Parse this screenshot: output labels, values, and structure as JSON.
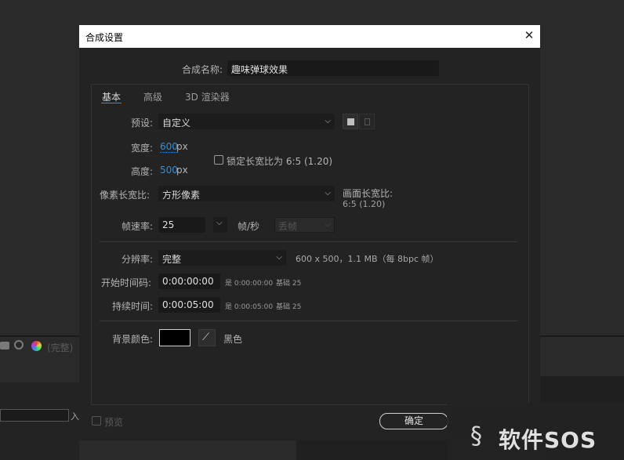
{
  "dialog": {
    "title": "合成设置",
    "close_glyph": "✕"
  },
  "comp_name": {
    "label": "合成名称:",
    "value": "趣味弹球效果"
  },
  "tabs": [
    {
      "label": "基本",
      "active": true
    },
    {
      "label": "高级",
      "active": false
    },
    {
      "label": "3D 渲染器",
      "active": false
    }
  ],
  "preset": {
    "label": "预设:",
    "value": "自定义"
  },
  "width": {
    "label": "宽度:",
    "value": "600",
    "unit": "px"
  },
  "height": {
    "label": "高度:",
    "value": "500",
    "unit": "px"
  },
  "lock_aspect": {
    "label": "锁定长宽比为 6:5 (1.20)",
    "checked": false
  },
  "pixel_aspect": {
    "label": "像素长宽比:",
    "value": "方形像素"
  },
  "frame_aspect": {
    "label": "画面长宽比:",
    "value": "6:5 (1.20)"
  },
  "frame_rate": {
    "label": "帧速率:",
    "value": "25",
    "unit": "帧/秒",
    "drop_frame": "丢帧"
  },
  "resolution": {
    "label": "分辨率:",
    "value": "完整",
    "info": "600 x 500，1.1 MB（每 8bpc 帧）"
  },
  "start_timecode": {
    "label": "开始时间码:",
    "value": "0:00:00:00",
    "note": "是 0:00:00:00",
    "base": "基础 25"
  },
  "duration": {
    "label": "持续时间:",
    "value": "0:00:05:00",
    "note": "是 0:00:05:00",
    "base": "基础 25"
  },
  "background": {
    "label": "背景颜色:",
    "color": "#000000",
    "name": "黑色"
  },
  "preview": {
    "label": "预览"
  },
  "ok_button": {
    "label": "确定"
  },
  "background_app": {
    "status_text": "(完整)",
    "input_text": "入"
  },
  "watermark": {
    "text": "软件SOS"
  },
  "colors": {
    "accent": "#2f8ee0",
    "dialog_bg": "#232323",
    "titlebar_bg": "#ffffff"
  }
}
